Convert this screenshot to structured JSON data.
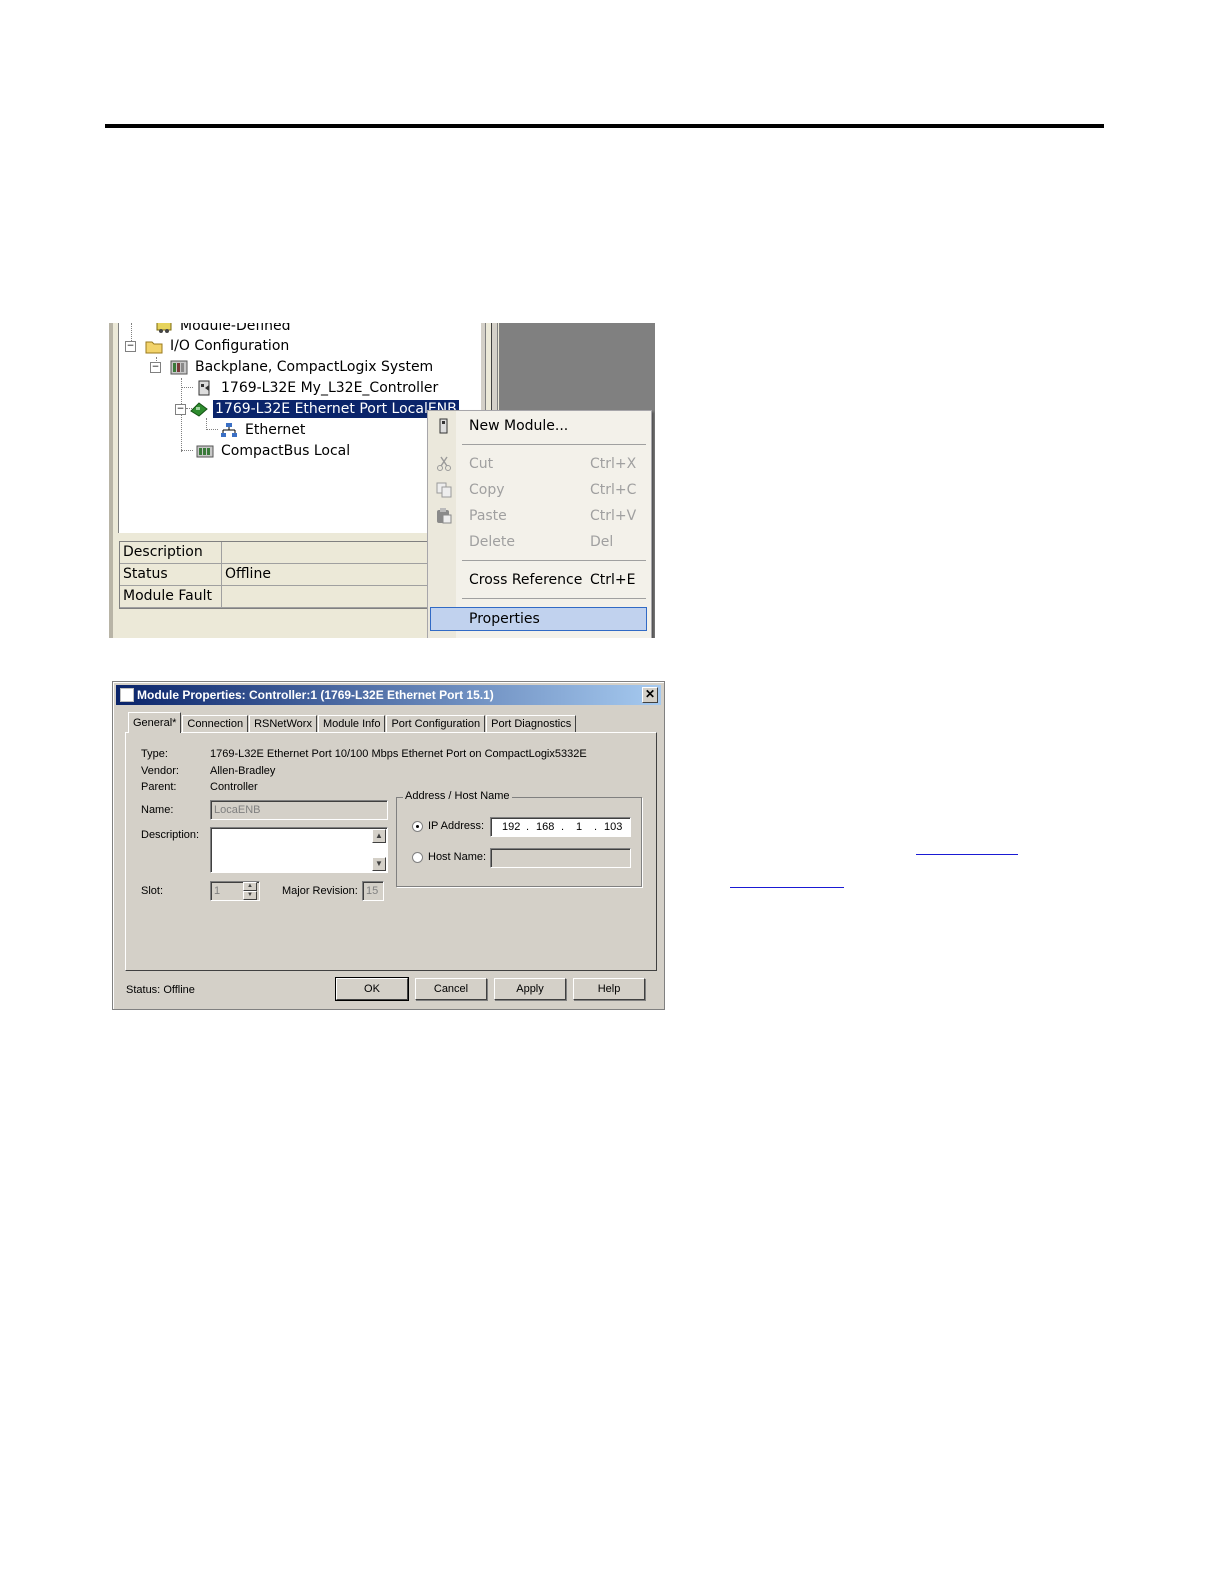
{
  "tree": {
    "items": [
      {
        "label": "Module-Defined",
        "icon": "module-defined-icon"
      },
      {
        "label": "I/O Configuration",
        "icon": "folder-icon"
      },
      {
        "label": "Backplane, CompactLogix System",
        "icon": "backplane-icon"
      },
      {
        "label": "1769-L32E My_L32E_Controller",
        "icon": "controller-icon"
      },
      {
        "label": "1769-L32E Ethernet Port LocalENB",
        "icon": "ethernet-port-icon"
      },
      {
        "label": "Ethernet",
        "icon": "network-icon"
      },
      {
        "label": "CompactBus Local",
        "icon": "compactbus-icon"
      }
    ]
  },
  "properties_grid": {
    "rows": [
      {
        "key": "Description",
        "value": ""
      },
      {
        "key": "Status",
        "value": "Offline"
      },
      {
        "key": "Module Fault",
        "value": ""
      }
    ]
  },
  "context_menu": {
    "new_module": "New Module...",
    "cut": "Cut",
    "cut_shortcut": "Ctrl+X",
    "copy": "Copy",
    "copy_shortcut": "Ctrl+C",
    "paste": "Paste",
    "paste_shortcut": "Ctrl+V",
    "delete": "Delete",
    "delete_shortcut": "Del",
    "cross_reference": "Cross Reference",
    "cross_reference_shortcut": "Ctrl+E",
    "properties": "Properties"
  },
  "dialog": {
    "title": "Module Properties: Controller:1 (1769-L32E Ethernet Port 15.1)",
    "close": "✕",
    "tabs": [
      "General*",
      "Connection",
      "RSNetWorx",
      "Module Info",
      "Port Configuration",
      "Port Diagnostics"
    ],
    "type_label": "Type:",
    "type_value": "1769-L32E Ethernet Port 10/100 Mbps Ethernet Port on CompactLogix5332E",
    "vendor_label": "Vendor:",
    "vendor_value": "Allen-Bradley",
    "parent_label": "Parent:",
    "parent_value": "Controller",
    "name_label": "Name:",
    "name_value": "LocaENB",
    "description_label": "Description:",
    "description_value": "",
    "slot_label": "Slot:",
    "slot_value": "1",
    "major_revision_label": "Major Revision:",
    "major_revision_value": "15",
    "address_group_title": "Address / Host Name",
    "ip_address_label": "IP Address:",
    "ip_octets": [
      "192",
      "168",
      "1",
      "103"
    ],
    "ip_separator": ".",
    "host_name_label": "Host Name:",
    "host_name_value": "",
    "status_label": "Status:",
    "status_value": "Offline",
    "ok": "OK",
    "cancel": "Cancel",
    "apply": "Apply",
    "help": "Help"
  },
  "colors": {
    "selection": "#0a246a",
    "menu_highlight": "#c1d2ee",
    "dialog_face": "#d4d0c8"
  }
}
